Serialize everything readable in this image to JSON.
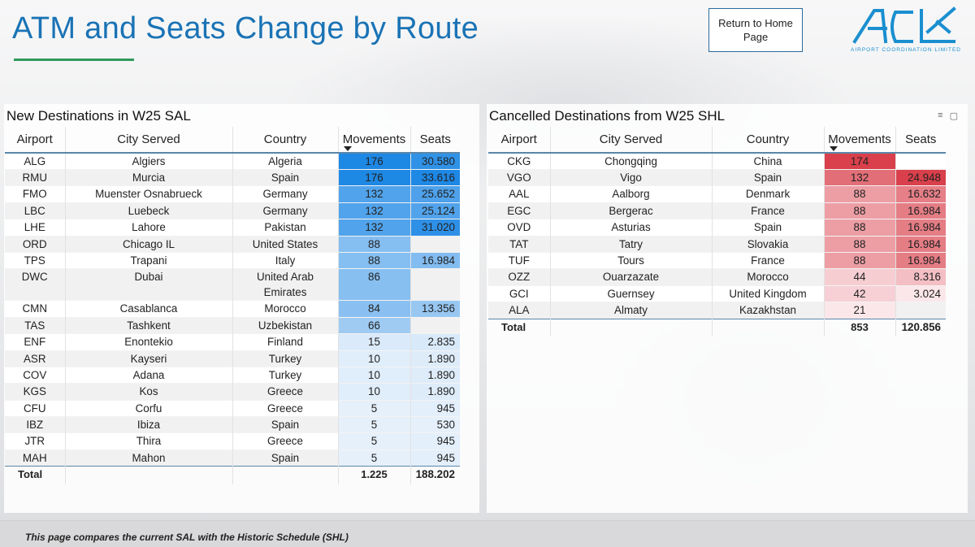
{
  "header": {
    "title": "ATM and Seats Change by Route",
    "home_button_label": "Return to Home Page",
    "logo_caption": "AIRPORT COORDINATION LIMITED"
  },
  "colors": {
    "title": "#1a73b5",
    "accent_rule": "#2e9a5a",
    "new_scale_max": "#1e88e5",
    "cancelled_scale_max": "#d9404b"
  },
  "new_destinations": {
    "title": "New Destinations in W25 SAL",
    "columns": [
      "Airport",
      "City Served",
      "Country",
      "Movements",
      "Seats"
    ],
    "sorted_column": "Movements",
    "rows": [
      {
        "airport": "ALG",
        "city": "Algiers",
        "country": "Algeria",
        "movements": "176",
        "seats": "30.580",
        "mov_val": 176,
        "seats_val": 30580
      },
      {
        "airport": "RMU",
        "city": "Murcia",
        "country": "Spain",
        "movements": "176",
        "seats": "33.616",
        "mov_val": 176,
        "seats_val": 33616
      },
      {
        "airport": "FMO",
        "city": "Muenster Osnabrueck",
        "country": "Germany",
        "movements": "132",
        "seats": "25.652",
        "mov_val": 132,
        "seats_val": 25652
      },
      {
        "airport": "LBC",
        "city": "Luebeck",
        "country": "Germany",
        "movements": "132",
        "seats": "25.124",
        "mov_val": 132,
        "seats_val": 25124
      },
      {
        "airport": "LHE",
        "city": "Lahore",
        "country": "Pakistan",
        "movements": "132",
        "seats": "31.020",
        "mov_val": 132,
        "seats_val": 31020
      },
      {
        "airport": "ORD",
        "city": "Chicago IL",
        "country": "United States",
        "movements": "88",
        "seats": "",
        "mov_val": 88,
        "seats_val": null
      },
      {
        "airport": "TPS",
        "city": "Trapani",
        "country": "Italy",
        "movements": "88",
        "seats": "16.984",
        "mov_val": 88,
        "seats_val": 16984
      },
      {
        "airport": "DWC",
        "city": "Dubai",
        "country": "United Arab Emirates",
        "movements": "86",
        "seats": "",
        "mov_val": 86,
        "seats_val": null
      },
      {
        "airport": "CMN",
        "city": "Casablanca",
        "country": "Morocco",
        "movements": "84",
        "seats": "13.356",
        "mov_val": 84,
        "seats_val": 13356
      },
      {
        "airport": "TAS",
        "city": "Tashkent",
        "country": "Uzbekistan",
        "movements": "66",
        "seats": "",
        "mov_val": 66,
        "seats_val": null
      },
      {
        "airport": "ENF",
        "city": "Enontekio",
        "country": "Finland",
        "movements": "15",
        "seats": "2.835",
        "mov_val": 15,
        "seats_val": 2835
      },
      {
        "airport": "ASR",
        "city": "Kayseri",
        "country": "Turkey",
        "movements": "10",
        "seats": "1.890",
        "mov_val": 10,
        "seats_val": 1890
      },
      {
        "airport": "COV",
        "city": "Adana",
        "country": "Turkey",
        "movements": "10",
        "seats": "1.890",
        "mov_val": 10,
        "seats_val": 1890
      },
      {
        "airport": "KGS",
        "city": "Kos",
        "country": "Greece",
        "movements": "10",
        "seats": "1.890",
        "mov_val": 10,
        "seats_val": 1890
      },
      {
        "airport": "CFU",
        "city": "Corfu",
        "country": "Greece",
        "movements": "5",
        "seats": "945",
        "mov_val": 5,
        "seats_val": 945
      },
      {
        "airport": "IBZ",
        "city": "Ibiza",
        "country": "Spain",
        "movements": "5",
        "seats": "530",
        "mov_val": 5,
        "seats_val": 530
      },
      {
        "airport": "JTR",
        "city": "Thira",
        "country": "Greece",
        "movements": "5",
        "seats": "945",
        "mov_val": 5,
        "seats_val": 945
      },
      {
        "airport": "MAH",
        "city": "Mahon",
        "country": "Spain",
        "movements": "5",
        "seats": "945",
        "mov_val": 5,
        "seats_val": 945
      }
    ],
    "total": {
      "label": "Total",
      "movements": "1.225",
      "seats": "188.202"
    }
  },
  "cancelled_destinations": {
    "title": "Cancelled Destinations from W25 SHL",
    "columns": [
      "Airport",
      "City Served",
      "Country",
      "Movements",
      "Seats"
    ],
    "sorted_column": "Movements",
    "rows": [
      {
        "airport": "CKG",
        "city": "Chongqing",
        "country": "China",
        "movements": "174",
        "seats": "",
        "mov_val": 174,
        "seats_val": null
      },
      {
        "airport": "VGO",
        "city": "Vigo",
        "country": "Spain",
        "movements": "132",
        "seats": "24.948",
        "mov_val": 132,
        "seats_val": 24948
      },
      {
        "airport": "AAL",
        "city": "Aalborg",
        "country": "Denmark",
        "movements": "88",
        "seats": "16.632",
        "mov_val": 88,
        "seats_val": 16632
      },
      {
        "airport": "EGC",
        "city": "Bergerac",
        "country": "France",
        "movements": "88",
        "seats": "16.984",
        "mov_val": 88,
        "seats_val": 16984
      },
      {
        "airport": "OVD",
        "city": "Asturias",
        "country": "Spain",
        "movements": "88",
        "seats": "16.984",
        "mov_val": 88,
        "seats_val": 16984
      },
      {
        "airport": "TAT",
        "city": "Tatry",
        "country": "Slovakia",
        "movements": "88",
        "seats": "16.984",
        "mov_val": 88,
        "seats_val": 16984
      },
      {
        "airport": "TUF",
        "city": "Tours",
        "country": "France",
        "movements": "88",
        "seats": "16.984",
        "mov_val": 88,
        "seats_val": 16984
      },
      {
        "airport": "OZZ",
        "city": "Ouarzazate",
        "country": "Morocco",
        "movements": "44",
        "seats": "8.316",
        "mov_val": 44,
        "seats_val": 8316
      },
      {
        "airport": "GCI",
        "city": "Guernsey",
        "country": "United Kingdom",
        "movements": "42",
        "seats": "3.024",
        "mov_val": 42,
        "seats_val": 3024
      },
      {
        "airport": "ALA",
        "city": "Almaty",
        "country": "Kazakhstan",
        "movements": "21",
        "seats": "",
        "mov_val": 21,
        "seats_val": null
      }
    ],
    "total": {
      "label": "Total",
      "movements": "853",
      "seats": "120.856"
    }
  },
  "footer": {
    "note": "This page compares the current SAL with the Historic Schedule (SHL)"
  }
}
